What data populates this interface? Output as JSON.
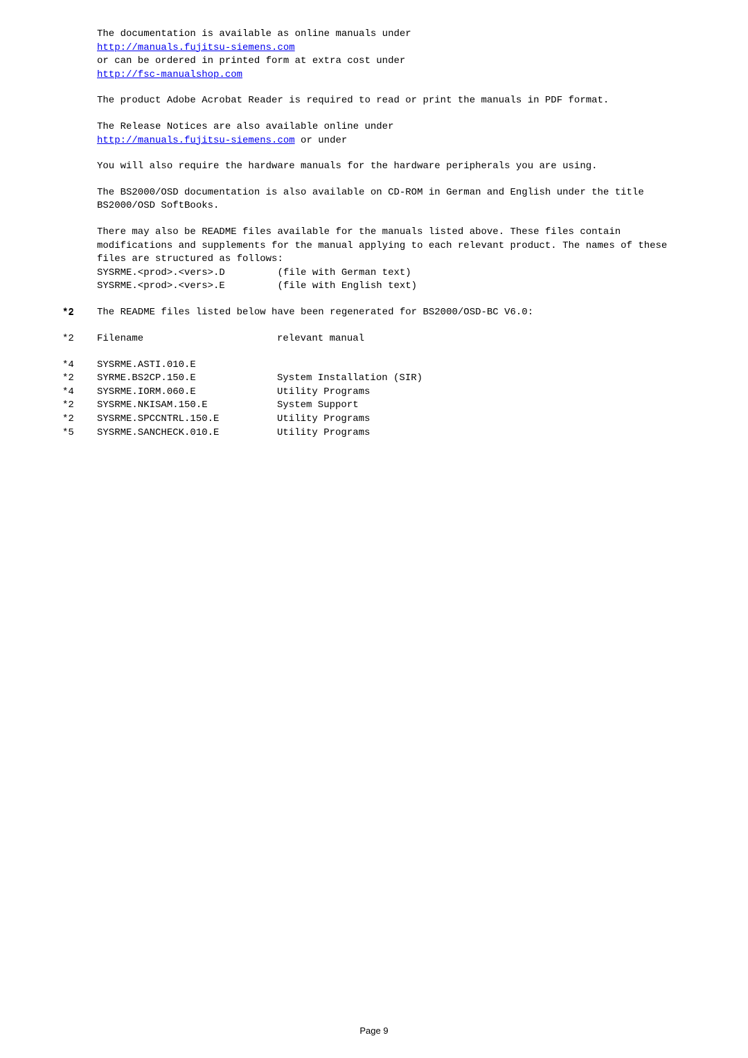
{
  "p1_line1": "The documentation is available as online manuals under",
  "p1_link1": "http://manuals.fujitsu-siemens.com",
  "p1_line3": "or can be ordered in printed form at extra cost under",
  "p1_link2": "http://fsc-manualshop.com",
  "p2": "The product Adobe Acrobat Reader is required to read or print the manuals in PDF format.",
  "p3_line1": "The Release Notices are also available online under",
  "p3_link": "http://manuals.fujitsu-siemens.com",
  "p3_after_link": " or under",
  "p4": "You will also require the hardware manuals for the hardware peripherals you are using.",
  "p5": "The BS2000/OSD documentation is also available on CD-ROM in German and English under the title BS2000/OSD SoftBooks.",
  "p6_line1": "There may also be README files available for the manuals listed above. These files contain modifications and supplements for the manual applying to each relevant product. The names of these files are structured as follows:",
  "p6_file1": "SYSRME.<prod>.<vers>.D         (file with German text)",
  "p6_file2": "SYSRME.<prod>.<vers>.E         (file with English text)",
  "p7_margin1": "*2",
  "p7_margin2": "*2",
  "p7_text": "The README files listed below have been regenerated for BS2000/OSD-BC V6.0:",
  "header_margin": "*2",
  "header_filename": "Filename",
  "header_manual": "relevant manual",
  "files": [
    {
      "margin": "*4",
      "name": "SYSRME.ASTI.010.E",
      "manual": ""
    },
    {
      "margin": "*2",
      "name": "SYRME.BS2CP.150.E",
      "manual": "System Installation (SIR)"
    },
    {
      "margin": "*4",
      "name": "SYSRME.IORM.060.E",
      "manual": "Utility Programs"
    },
    {
      "margin": "*2",
      "name": "SYSRME.NKISAM.150.E",
      "manual": "System Support"
    },
    {
      "margin": "*2",
      "name": "SYSRME.SPCCNTRL.150.E",
      "manual": "Utility Programs"
    },
    {
      "margin": "*5",
      "name": "SYSRME.SANCHECK.010.E",
      "manual": "Utility Programs"
    }
  ],
  "footer": "Page 9"
}
